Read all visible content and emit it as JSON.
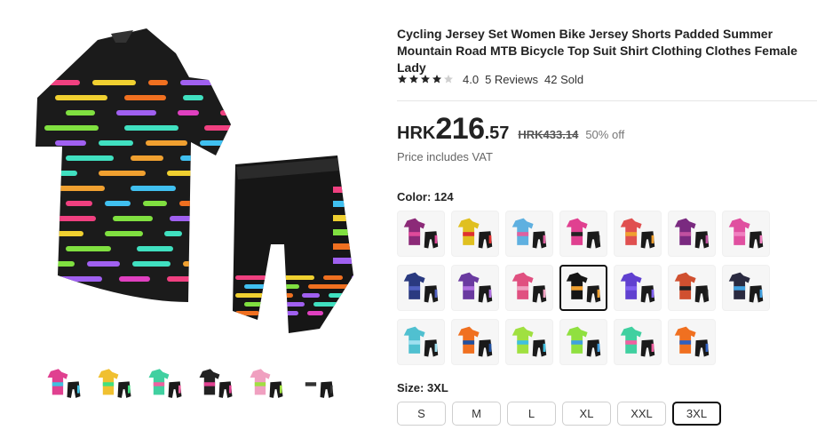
{
  "product": {
    "title": "Cycling Jersey Set Women Bike Jersey Shorts Padded Summer Mountain Road MTB Bicycle Top Suit Shirt Clothing Clothes Female Lady",
    "rating": 4.0,
    "rating_text": "4.0",
    "reviews_text": "5 Reviews",
    "sold_text": "42 Sold"
  },
  "price": {
    "currency": "HRK",
    "integer": "216",
    "decimal": ".57",
    "original": "HRK433.14",
    "discount": "50% off",
    "vat_note": "Price includes VAT"
  },
  "color": {
    "label": "Color: 124",
    "selected_index": 10,
    "swatches": [
      {
        "top": "#8c2a78",
        "bottom": "#1a1a1a",
        "accent": "#e04a9a"
      },
      {
        "top": "#e0c020",
        "bottom": "#1a1a1a",
        "accent": "#e03030"
      },
      {
        "top": "#5fb0e0",
        "bottom": "#1a1a1a",
        "accent": "#e060a0"
      },
      {
        "top": "#e04090",
        "bottom": "#1a1a1a",
        "accent": "#222222"
      },
      {
        "top": "#e05050",
        "bottom": "#1a1a1a",
        "accent": "#f0a030"
      },
      {
        "top": "#7a2a80",
        "bottom": "#1a1a1a",
        "accent": "#c050a0"
      },
      {
        "top": "#e050a0",
        "bottom": "#1a1a1a",
        "accent": "#f080c0"
      },
      {
        "top": "#2a3a80",
        "bottom": "#1a1a1a",
        "accent": "#5060c0"
      },
      {
        "top": "#6a3aa0",
        "bottom": "#1a1a1a",
        "accent": "#b070e0"
      },
      {
        "top": "#e05080",
        "bottom": "#1a1a1a",
        "accent": "#f0a0c0"
      },
      {
        "top": "#151515",
        "bottom": "#1a1a1a",
        "accent": "#f0a030"
      },
      {
        "top": "#6040d0",
        "bottom": "#1a1a1a",
        "accent": "#8060f0"
      },
      {
        "top": "#d05030",
        "bottom": "#1a1a1a",
        "accent": "#222222"
      },
      {
        "top": "#2a2a40",
        "bottom": "#1a1a1a",
        "accent": "#40a0e0"
      },
      {
        "top": "#50c0d0",
        "bottom": "#1a1a1a",
        "accent": "#a0e0f0"
      },
      {
        "top": "#f07020",
        "bottom": "#1a1a1a",
        "accent": "#2050a0"
      },
      {
        "top": "#a0e040",
        "bottom": "#1a1a1a",
        "accent": "#40c0e0"
      },
      {
        "top": "#90e040",
        "bottom": "#1a1a1a",
        "accent": "#40a0e0"
      },
      {
        "top": "#40d0a0",
        "bottom": "#1a1a1a",
        "accent": "#f060a0"
      },
      {
        "top": "#f07020",
        "bottom": "#1a1a1a",
        "accent": "#3060c0"
      }
    ]
  },
  "size": {
    "label": "Size: 3XL",
    "options": [
      "S",
      "M",
      "L",
      "XL",
      "XXL",
      "3XL"
    ],
    "selected": "3XL"
  },
  "gallery": {
    "thumbs": [
      {
        "top": "#e04090",
        "accent": "#40c0e0"
      },
      {
        "top": "#f0c030",
        "accent": "#40e080"
      },
      {
        "top": "#40d0a0",
        "accent": "#f060a0"
      },
      {
        "top": "#222222",
        "accent": "#e04090"
      },
      {
        "top": "#f0a0c0",
        "accent": "#a0e040"
      },
      {
        "top": "#ffffff",
        "accent": "#333333"
      }
    ]
  }
}
